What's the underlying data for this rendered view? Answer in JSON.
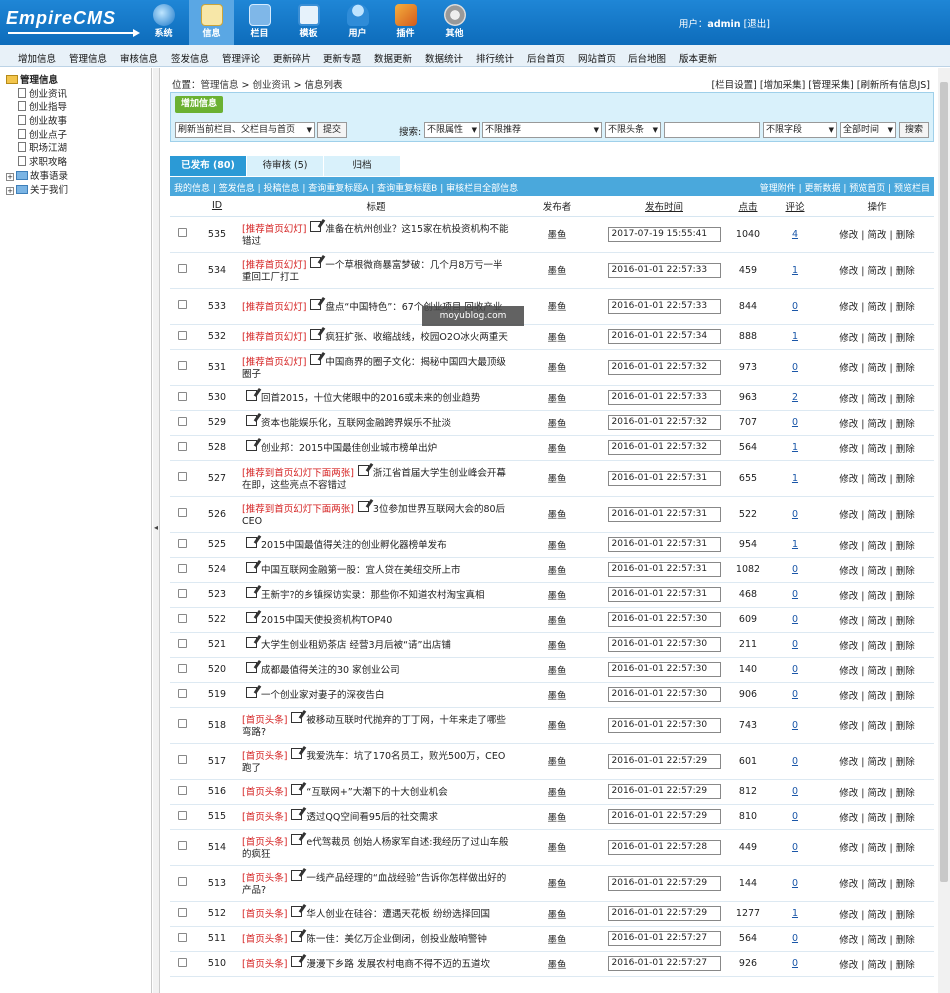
{
  "brand": "EmpireCMS",
  "nav": [
    {
      "label": "系统"
    },
    {
      "label": "信息"
    },
    {
      "label": "栏目"
    },
    {
      "label": "模板"
    },
    {
      "label": "用户"
    },
    {
      "label": "插件"
    },
    {
      "label": "其他"
    }
  ],
  "user": {
    "prefix": "用户：",
    "name": "admin",
    "logout": "[退出]"
  },
  "menu": [
    "增加信息",
    "管理信息",
    "审核信息",
    "签发信息",
    "管理评论",
    "更新碎片",
    "更新专题",
    "数据更新",
    "数据统计",
    "排行统计",
    "后台首页",
    "网站首页",
    "后台地图",
    "版本更新"
  ],
  "tree": {
    "root": "管理信息",
    "items": [
      "创业资讯",
      "创业指导",
      "创业故事",
      "创业点子",
      "职场江湖",
      "求职攻略"
    ],
    "groups": [
      "故事语录",
      "关于我们"
    ]
  },
  "breadcrumb": {
    "prefix": "位置：",
    "p1": "管理信息",
    "sep1": " > ",
    "p2": "创业资讯",
    "sep2": " > ",
    "p3": "信息列表"
  },
  "right_links": "[栏目设置] [增加采集] [管理采集] [刷新所有信息JS]",
  "toolbar": {
    "add": "增加信息",
    "refresh_select": "刷新当前栏目、父栏目与首页",
    "submit": "提交",
    "search_label": "搜索:",
    "attr": "不限属性",
    "recommend": "不限推荐",
    "headline": "不限头条",
    "field": "不限字段",
    "time": "全部时间",
    "search_btn": "搜索"
  },
  "tabs": [
    "已发布 (80)",
    "待审核 (5)",
    "归档"
  ],
  "subbar_left": "我的信息 | 签发信息 | 投稿信息 | 查询重复标题A | 查询重复标题B | 审核栏目全部信息",
  "subbar_right": "管理附件 | 更新数据 | 预览首页 | 预览栏目",
  "headers": {
    "id": "ID",
    "title": "标题",
    "author": "发布者",
    "date": "发布时间",
    "clicks": "点击",
    "comments": "评论",
    "ops": "操作"
  },
  "ops": {
    "edit": "修改",
    "simple": "简改",
    "del": "删除",
    "sep": " | "
  },
  "watermark": "moyublog.com",
  "rows": [
    {
      "id": "535",
      "tag": "[推荐首页幻灯]",
      "title": "准备在杭州创业？这15家在杭投资机构不能错过",
      "author": "墨鱼",
      "date": "2017-07-19 15:55:41",
      "clicks": "1040",
      "comments": "4"
    },
    {
      "id": "534",
      "tag": "[推荐首页幻灯]",
      "title": "一个草根微商暴富梦破：几个月8万亏一半 重回工厂打工",
      "author": "墨鱼",
      "date": "2016-01-01 22:57:33",
      "clicks": "459",
      "comments": "1"
    },
    {
      "id": "533",
      "tag": "[推荐首页幻灯]",
      "title": "盘点“中国特色”：67个创业项目 回收产业",
      "author": "墨鱼",
      "date": "2016-01-01 22:57:33",
      "clicks": "844",
      "comments": "0"
    },
    {
      "id": "532",
      "tag": "[推荐首页幻灯]",
      "title": "疯狂扩张、收缩战线，校园O2O冰火两重天",
      "author": "墨鱼",
      "date": "2016-01-01 22:57:34",
      "clicks": "888",
      "comments": "1"
    },
    {
      "id": "531",
      "tag": "[推荐首页幻灯]",
      "title": "中国商界的圈子文化：揭秘中国四大最顶级圈子",
      "author": "墨鱼",
      "date": "2016-01-01 22:57:32",
      "clicks": "973",
      "comments": "0"
    },
    {
      "id": "530",
      "tag": "",
      "title": "回首2015，十位大佬眼中的2016或未来的创业趋势",
      "author": "墨鱼",
      "date": "2016-01-01 22:57:33",
      "clicks": "963",
      "comments": "2"
    },
    {
      "id": "529",
      "tag": "",
      "title": "资本也能娱乐化，互联网金融跨界娱乐不扯淡",
      "author": "墨鱼",
      "date": "2016-01-01 22:57:32",
      "clicks": "707",
      "comments": "0"
    },
    {
      "id": "528",
      "tag": "",
      "title": "创业邦：2015中国最佳创业城市榜单出炉",
      "author": "墨鱼",
      "date": "2016-01-01 22:57:32",
      "clicks": "564",
      "comments": "1"
    },
    {
      "id": "527",
      "tag": "[推荐到首页幻灯下面两张]",
      "title": "浙江省首届大学生创业峰会开幕在即，这些亮点不容错过",
      "author": "墨鱼",
      "date": "2016-01-01 22:57:31",
      "clicks": "655",
      "comments": "1"
    },
    {
      "id": "526",
      "tag": "[推荐到首页幻灯下面两张]",
      "title": "3位参加世界互联网大会的80后CEO",
      "author": "墨鱼",
      "date": "2016-01-01 22:57:31",
      "clicks": "522",
      "comments": "0"
    },
    {
      "id": "525",
      "tag": "",
      "title": "2015中国最值得关注的创业孵化器榜单发布",
      "author": "墨鱼",
      "date": "2016-01-01 22:57:31",
      "clicks": "954",
      "comments": "1"
    },
    {
      "id": "524",
      "tag": "",
      "title": "中国互联网金融第一股：宜人贷在美纽交所上市",
      "author": "墨鱼",
      "date": "2016-01-01 22:57:31",
      "clicks": "1082",
      "comments": "0"
    },
    {
      "id": "523",
      "tag": "",
      "title": "王新宇?的乡镇探访实录：那些你不知道农村淘宝真相",
      "author": "墨鱼",
      "date": "2016-01-01 22:57:31",
      "clicks": "468",
      "comments": "0"
    },
    {
      "id": "522",
      "tag": "",
      "title": "2015中国天使投资机构TOP40",
      "author": "墨鱼",
      "date": "2016-01-01 22:57:30",
      "clicks": "609",
      "comments": "0"
    },
    {
      "id": "521",
      "tag": "",
      "title": "大学生创业租奶茶店 经营3月后被“请”出店铺",
      "author": "墨鱼",
      "date": "2016-01-01 22:57:30",
      "clicks": "211",
      "comments": "0"
    },
    {
      "id": "520",
      "tag": "",
      "title": "成都最值得关注的30 家创业公司",
      "author": "墨鱼",
      "date": "2016-01-01 22:57:30",
      "clicks": "140",
      "comments": "0"
    },
    {
      "id": "519",
      "tag": "",
      "title": "一个创业家对妻子的深夜告白",
      "author": "墨鱼",
      "date": "2016-01-01 22:57:30",
      "clicks": "906",
      "comments": "0"
    },
    {
      "id": "518",
      "tag": "[首页头条]",
      "title": "被移动互联时代抛弃的丁丁网，十年来走了哪些弯路?",
      "author": "墨鱼",
      "date": "2016-01-01 22:57:30",
      "clicks": "743",
      "comments": "0"
    },
    {
      "id": "517",
      "tag": "[首页头条]",
      "title": "我爱洗车：坑了170名员工，败光500万，CEO跑了",
      "author": "墨鱼",
      "date": "2016-01-01 22:57:29",
      "clicks": "601",
      "comments": "0"
    },
    {
      "id": "516",
      "tag": "[首页头条]",
      "title": "“互联网+”大潮下的十大创业机会",
      "author": "墨鱼",
      "date": "2016-01-01 22:57:29",
      "clicks": "812",
      "comments": "0"
    },
    {
      "id": "515",
      "tag": "[首页头条]",
      "title": "透过QQ空间看95后的社交需求",
      "author": "墨鱼",
      "date": "2016-01-01 22:57:29",
      "clicks": "810",
      "comments": "0"
    },
    {
      "id": "514",
      "tag": "[首页头条]",
      "title": "e代驾裁员 创始人杨家军自述:我经历了过山车般的疯狂",
      "author": "墨鱼",
      "date": "2016-01-01 22:57:28",
      "clicks": "449",
      "comments": "0"
    },
    {
      "id": "513",
      "tag": "[首页头条]",
      "title": "一线产品经理的“血战经验”告诉你怎样做出好的产品?",
      "author": "墨鱼",
      "date": "2016-01-01 22:57:29",
      "clicks": "144",
      "comments": "0"
    },
    {
      "id": "512",
      "tag": "[首页头条]",
      "title": "华人创业在硅谷：遭遇天花板 纷纷选择回国",
      "author": "墨鱼",
      "date": "2016-01-01 22:57:29",
      "clicks": "1277",
      "comments": "1"
    },
    {
      "id": "511",
      "tag": "[首页头条]",
      "title": "陈一佳：美亿万企业倒闭，创投业敲响警钟",
      "author": "墨鱼",
      "date": "2016-01-01 22:57:27",
      "clicks": "564",
      "comments": "0"
    },
    {
      "id": "510",
      "tag": "[首页头条]",
      "title": "漫漫下乡路 发展农村电商不得不迈的五道坎",
      "author": "墨鱼",
      "date": "2016-01-01 22:57:27",
      "clicks": "926",
      "comments": "0"
    }
  ]
}
